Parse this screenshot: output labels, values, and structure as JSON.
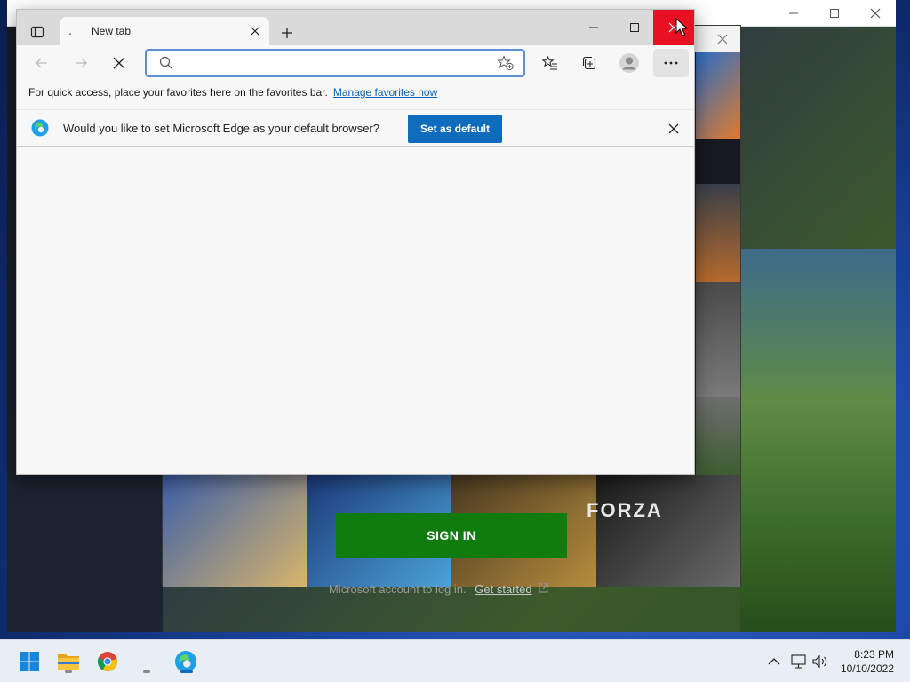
{
  "edge": {
    "tab_favicon": ".",
    "tab_title": "New tab",
    "address_placeholder": "",
    "address_value": "",
    "favorites_bar_text": "For quick access, place your favorites here on the favorites bar.",
    "favorites_bar_link": "Manage favorites now",
    "infobar_message": "Would you like to set Microsoft Edge as your default browser?",
    "set_default_label": "Set as default"
  },
  "xbox": {
    "sign_in_label": "SIGN IN",
    "account_text": "Microsoft account to log in.",
    "get_started_label": "Get started",
    "game_title_text": "FORZA",
    "brand_green": "#107c10"
  },
  "taskbar": {
    "apps": [
      "start-icon",
      "file-explorer-icon",
      "chrome-icon",
      "edge-icon"
    ],
    "time": "8:23 PM",
    "date": "10/10/2022"
  },
  "colors": {
    "edge_accent": "#0f6cbd",
    "close_red": "#e81123"
  }
}
